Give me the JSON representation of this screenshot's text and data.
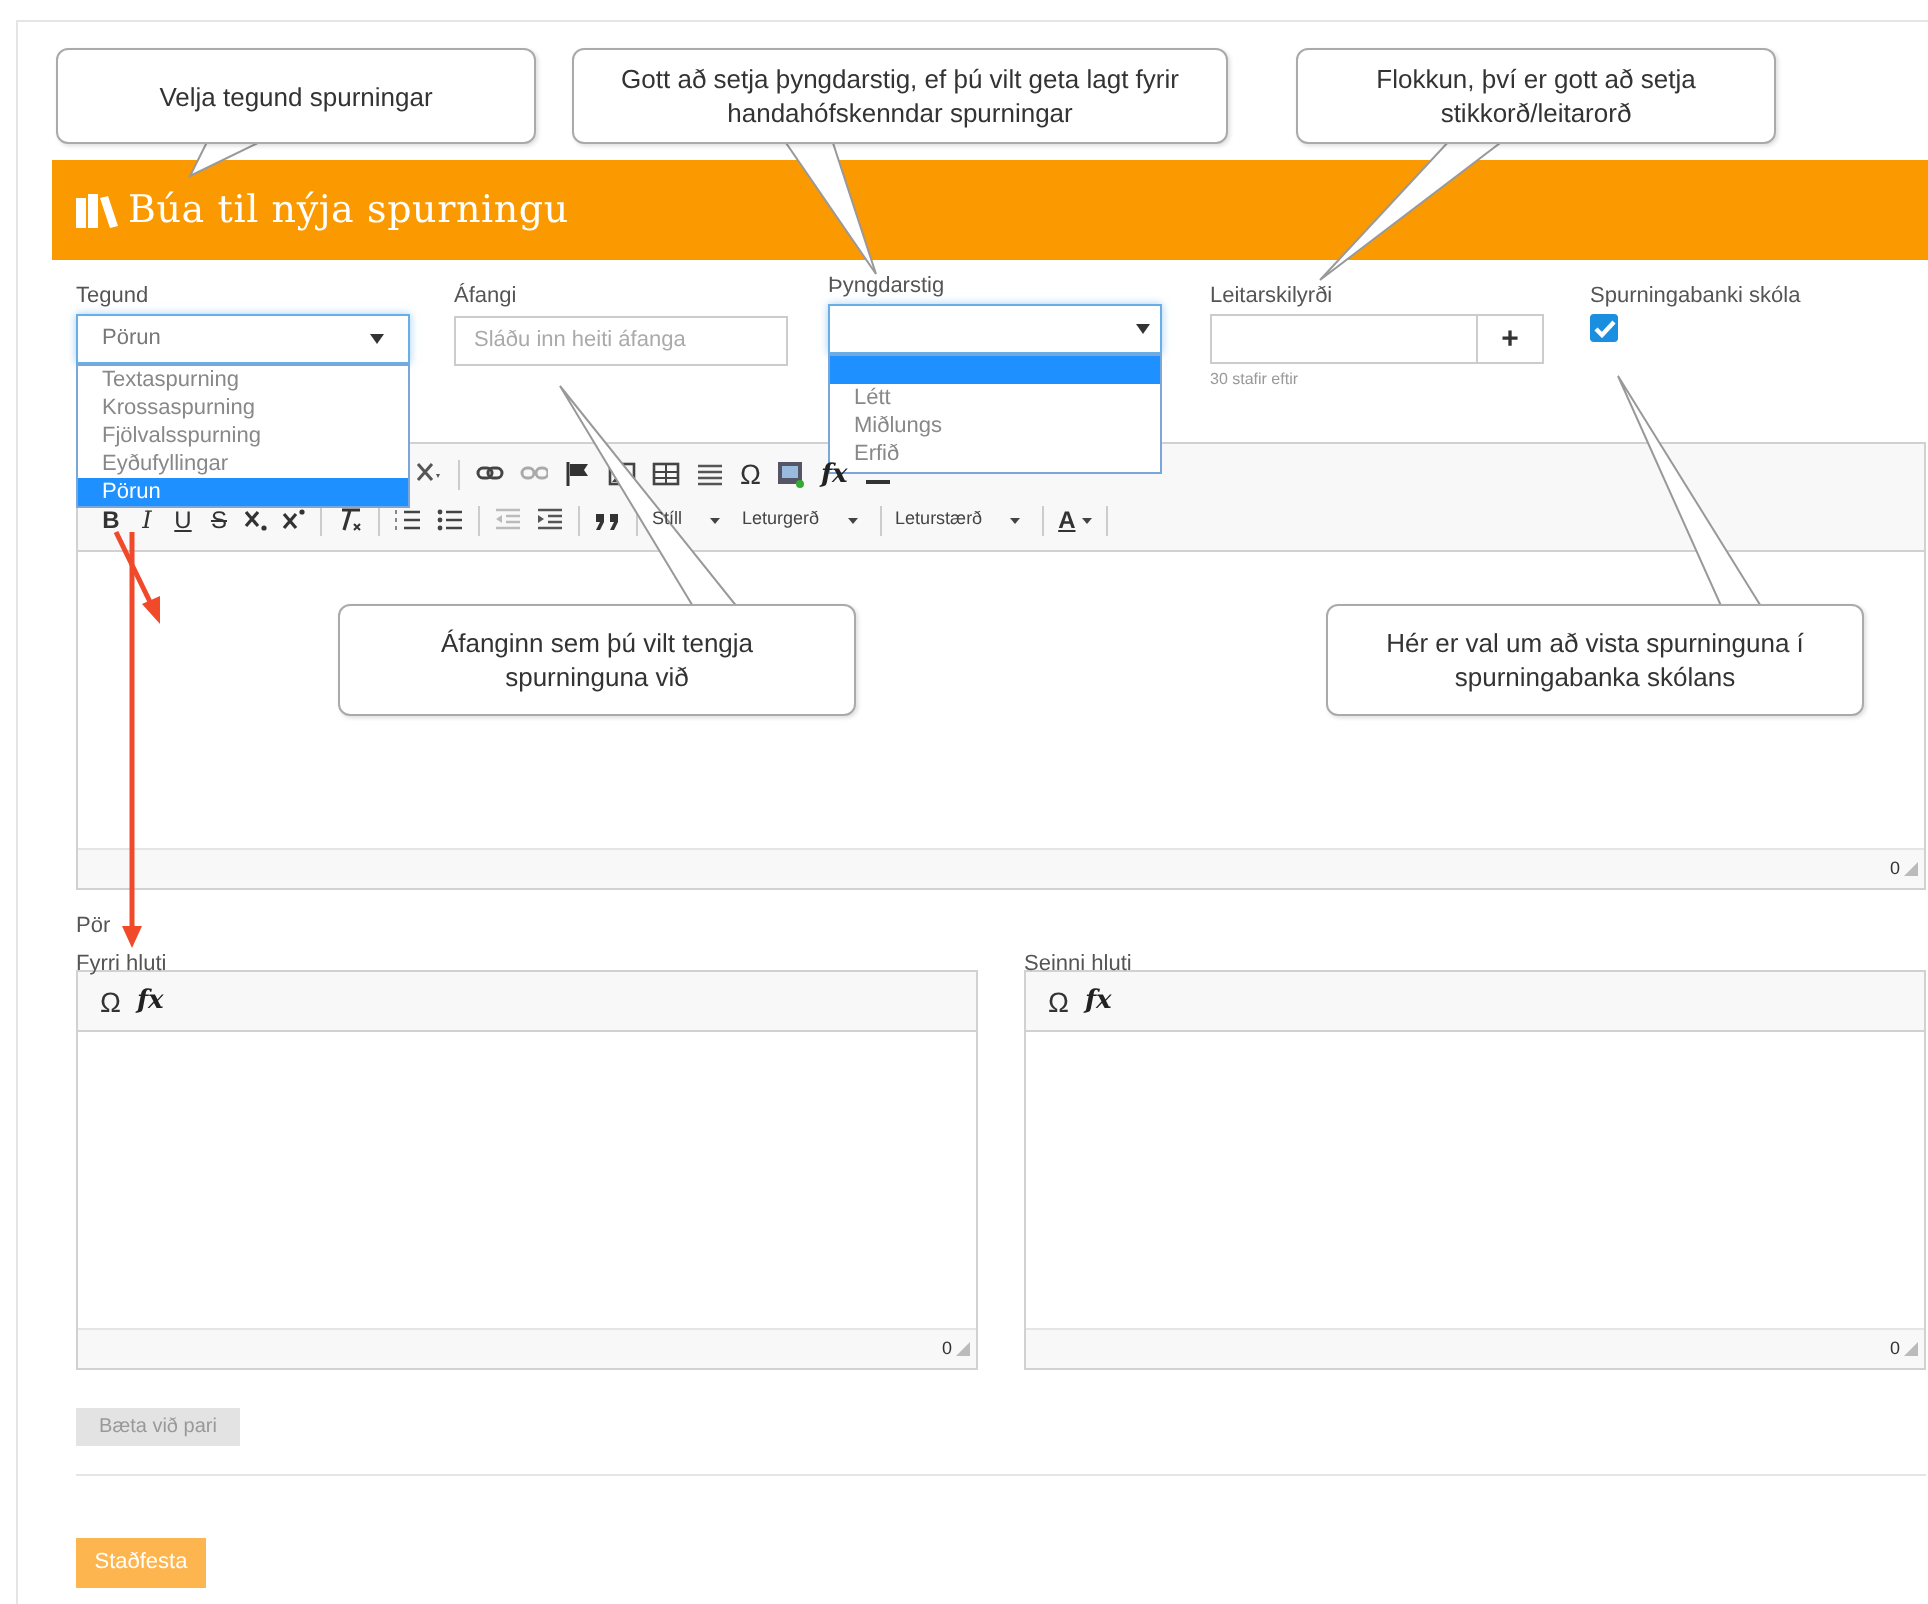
{
  "callouts": [
    {
      "text": "Velja tegund spurningar"
    },
    {
      "text": "Gott að setja þyngdarstig, ef þú vilt geta lagt fyrir handahófskenndar spurningar"
    },
    {
      "text": "Flokkun, því er gott að setja stikkorð/leitarorð"
    },
    {
      "text": "Áfanginn sem þú vilt tengja spurninguna við"
    },
    {
      "text": "Hér er val um að vista spurninguna í spurningabanka skólans"
    }
  ],
  "header": {
    "title": "Búa til nýja spurningu"
  },
  "type_field": {
    "label": "Tegund",
    "value": "Pörun",
    "expanded": true,
    "options": [
      {
        "label": "Textaspurning",
        "selected": false
      },
      {
        "label": "Krossaspurning",
        "selected": false
      },
      {
        "label": "Fjölvalsspurning",
        "selected": false
      },
      {
        "label": "Eyðufyllingar",
        "selected": false
      },
      {
        "label": "Pörun",
        "selected": true
      }
    ]
  },
  "course_field": {
    "label": "Áfangi",
    "placeholder": "Sláðu inn heiti áfanga"
  },
  "difficulty_field": {
    "label": "Þyngdarstig",
    "expanded": true,
    "options": [
      {
        "kind": "blank",
        "selected": true
      },
      {
        "kind": "text",
        "label": "Létt",
        "selected": false
      },
      {
        "kind": "text",
        "label": "Miðlungs",
        "selected": false
      },
      {
        "kind": "text",
        "label": "Erfið",
        "selected": false
      }
    ]
  },
  "search_terms": {
    "label": "Leitarskilyrði",
    "add_button": "+",
    "hint": "30 stafir eftir"
  },
  "school_bank": {
    "label": "Spurningabanki skóla",
    "checked": true
  },
  "editor": {
    "toolbar_row_1": [
      {
        "kind": "icon"
      },
      {
        "kind": "sep"
      },
      {
        "kind": "icon"
      },
      {
        "kind": "icon"
      },
      {
        "kind": "icon"
      },
      {
        "kind": "icon"
      },
      {
        "kind": "icon"
      },
      {
        "kind": "icon"
      },
      {
        "kind": "glyph",
        "text": "Ω"
      },
      {
        "kind": "icon"
      },
      {
        "kind": "fx",
        "text": "fx"
      },
      {
        "kind": "icon"
      }
    ],
    "toolbar_row_2": [
      {
        "kind": "bold",
        "text": "B"
      },
      {
        "kind": "italic",
        "text": "I"
      },
      {
        "kind": "underline",
        "text": "U"
      },
      {
        "kind": "strike",
        "text": "S"
      },
      {
        "kind": "icon"
      },
      {
        "kind": "icon"
      },
      {
        "kind": "sep"
      },
      {
        "kind": "icon"
      },
      {
        "kind": "sep"
      },
      {
        "kind": "icon"
      },
      {
        "kind": "icon"
      },
      {
        "kind": "sep"
      },
      {
        "kind": "icon"
      },
      {
        "kind": "icon"
      },
      {
        "kind": "sep"
      },
      {
        "kind": "icon"
      },
      {
        "kind": "sep"
      },
      {
        "kind": "combo",
        "text": "Stíll"
      },
      {
        "kind": "combo",
        "text": "Leturgerð"
      },
      {
        "kind": "sep"
      },
      {
        "kind": "combo",
        "text": "Leturstærð"
      },
      {
        "kind": "sep"
      },
      {
        "kind": "color",
        "text": "A"
      },
      {
        "kind": "sep"
      }
    ],
    "counter": "0"
  },
  "pairs": {
    "label": "Pör",
    "editors": [
      {
        "label": "Fyrri hluti",
        "toolbar": [
          {
            "kind": "glyph",
            "text": "Ω"
          },
          {
            "kind": "fx",
            "text": "fx"
          }
        ],
        "counter": "0"
      },
      {
        "label": "Seinni hluti",
        "toolbar": [
          {
            "kind": "glyph",
            "text": "Ω"
          },
          {
            "kind": "fx",
            "text": "fx"
          }
        ],
        "counter": "0"
      }
    ]
  },
  "add_pair_button": {
    "label": "Bæta við pari",
    "disabled": true
  },
  "submit_button": {
    "label": "Staðfesta"
  }
}
